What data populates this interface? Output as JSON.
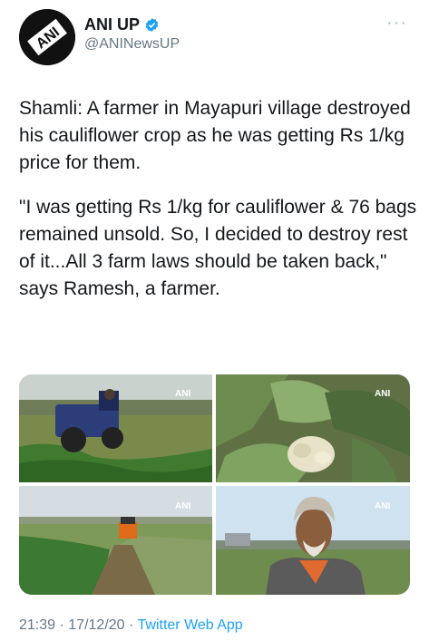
{
  "tweet": {
    "author_name": "ANI UP",
    "author_handle": "@ANINewsUP",
    "avatar_text": "ANI",
    "paragraph1": "Shamli: A farmer in Mayapuri village destroyed his cauliflower crop as he was getting Rs 1/kg price for them.",
    "paragraph2": "\"I was getting Rs 1/kg for cauliflower & 76 bags remained unsold. So, I decided to destroy rest of it...All 3 farm laws should be taken back,\" says Ramesh, a farmer.",
    "time": "21:39",
    "date": "17/12/20",
    "separator": "·",
    "source": "Twitter Web App"
  },
  "media": {
    "watermark": "ANI",
    "images": [
      {
        "subject": "tractor-in-field"
      },
      {
        "subject": "cauliflower-closeup"
      },
      {
        "subject": "tractor-in-distance"
      },
      {
        "subject": "farmer-portrait"
      }
    ]
  },
  "colors": {
    "text": "#14171a",
    "secondary": "#657786",
    "accent": "#1da1f2"
  },
  "icons": [
    "verified-badge-icon",
    "more-options-icon"
  ]
}
